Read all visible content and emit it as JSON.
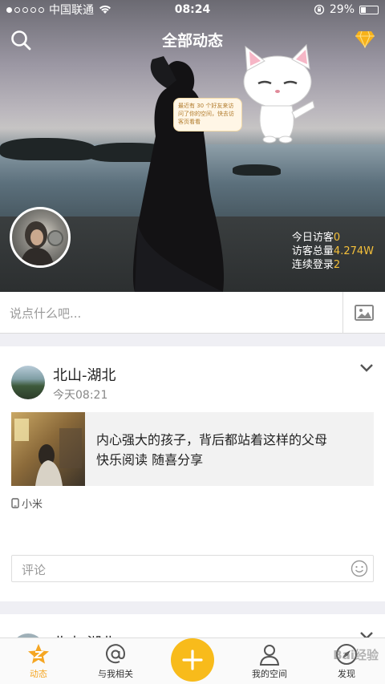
{
  "status_bar": {
    "carrier": "中国联通",
    "time": "08:24",
    "battery": "29%",
    "battery_level": 0.29
  },
  "header": {
    "title": "全部动态"
  },
  "cat_bubble": {
    "text": "最近有 30 个好友来访问了你的空间，快去访客页看看"
  },
  "stats": {
    "today_label": "今日访客",
    "today_value": "0",
    "total_label": "访客总量",
    "total_value": "4.274W",
    "streak_label": "连续登录",
    "streak_value": "2"
  },
  "compose": {
    "placeholder": "说点什么吧..."
  },
  "post": {
    "user": "北山-湖北",
    "time": "今天08:21",
    "share_line1": "内心强大的孩子，背后都站着这样的父母",
    "share_line2": "快乐阅读 随喜分享",
    "device": "小米",
    "comment_placeholder": "评论"
  },
  "post2": {
    "user": "北山-湖北"
  },
  "tabbar": {
    "items": [
      {
        "label": "动态"
      },
      {
        "label": "与我相关"
      },
      {
        "label": "我的空间"
      },
      {
        "label": "发现"
      }
    ]
  },
  "colors": {
    "accent": "#f8bb1b",
    "stat_number": "#f5c03a"
  },
  "watermark": "Bai经验"
}
